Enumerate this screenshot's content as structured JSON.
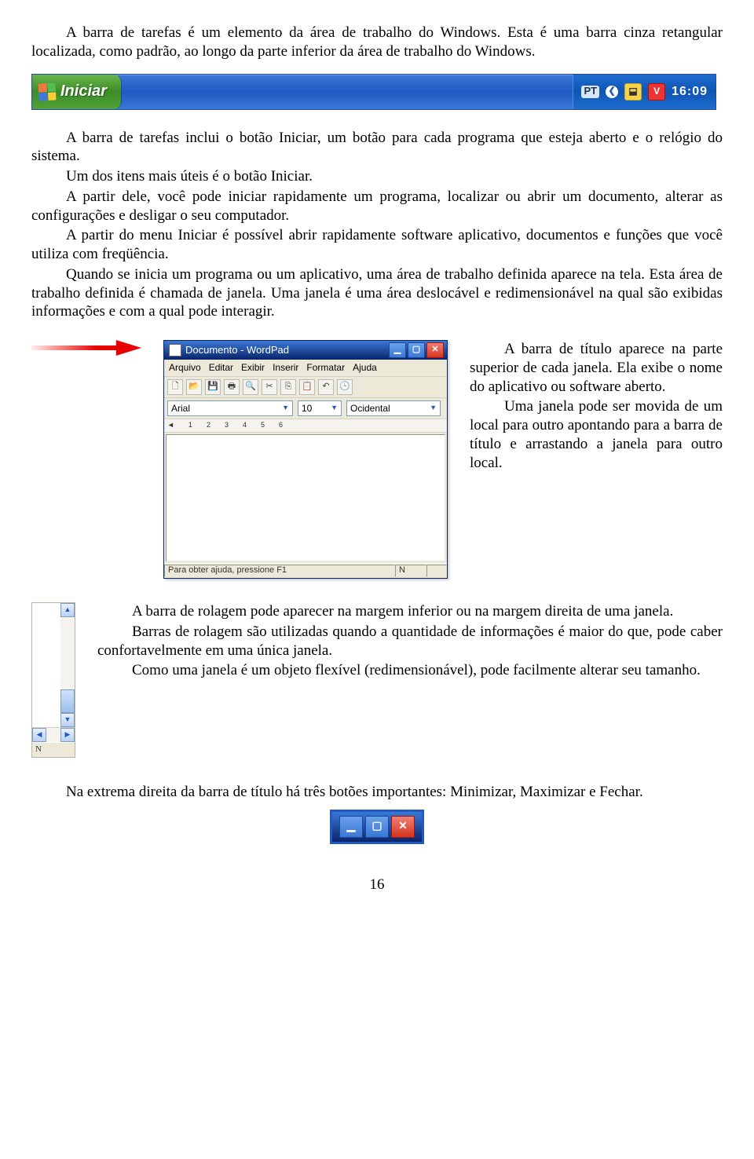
{
  "para1": "A barra de tarefas é um elemento da área de trabalho do Windows. Esta é uma barra cinza retangular localizada, como padrão, ao longo da parte inferior da área de trabalho do Windows.",
  "taskbar": {
    "start_label": "Iniciar",
    "lang": "PT",
    "clock": "16:09"
  },
  "para2a": "A barra de tarefas inclui o botão Iniciar, um botão para cada programa que esteja aberto e o relógio do sistema.",
  "para2b": "Um dos itens mais úteis é o botão Iniciar.",
  "para2c": "A partir dele, você pode iniciar rapidamente um programa, localizar ou abrir um documento, alterar as configurações e desligar o seu computador.",
  "para2d": "A partir do menu Iniciar é possível abrir rapidamente software aplicativo, documentos e funções que você utiliza com freqüência.",
  "para2e": "Quando se inicia um programa ou um aplicativo, uma área de trabalho definida aparece na tela. Esta área de trabalho definida é chamada de janela. Uma janela é uma área deslocável e redimensionável na qual são exibidas informações e com a qual pode interagir.",
  "wordpad": {
    "title": "Documento - WordPad",
    "menus": [
      "Arquivo",
      "Editar",
      "Exibir",
      "Inserir",
      "Formatar",
      "Ajuda"
    ],
    "font_name": "Arial",
    "font_size": "10",
    "font_script": "Ocidental",
    "ruler_marks": [
      "1",
      "2",
      "3",
      "4",
      "5",
      "6"
    ],
    "status_text": "Para obter ajuda, pressione F1",
    "status_right": "N"
  },
  "right1": "A barra de título aparece na parte superior de cada janela. Ela exibe o nome do aplicativo ou software aberto.",
  "right2": "Uma janela pode ser movida de um local para outro apontando para a barra de título e arrastando a janela para outro local.",
  "scroll_status": "N",
  "scroll1": "A barra de rolagem pode aparecer na margem inferior ou na margem direita de uma janela.",
  "scroll2": "Barras de rolagem são utilizadas quando a quantidade de informações é maior do que, pode caber confortavelmente em uma única janela.",
  "scroll3": "Como uma janela é um objeto flexível (redimensionável), pode facilmente alterar seu tamanho.",
  "para_last": "Na extrema direita da barra de título há três botões importantes: Minimizar, Maximizar e Fechar.",
  "page_number": "16"
}
